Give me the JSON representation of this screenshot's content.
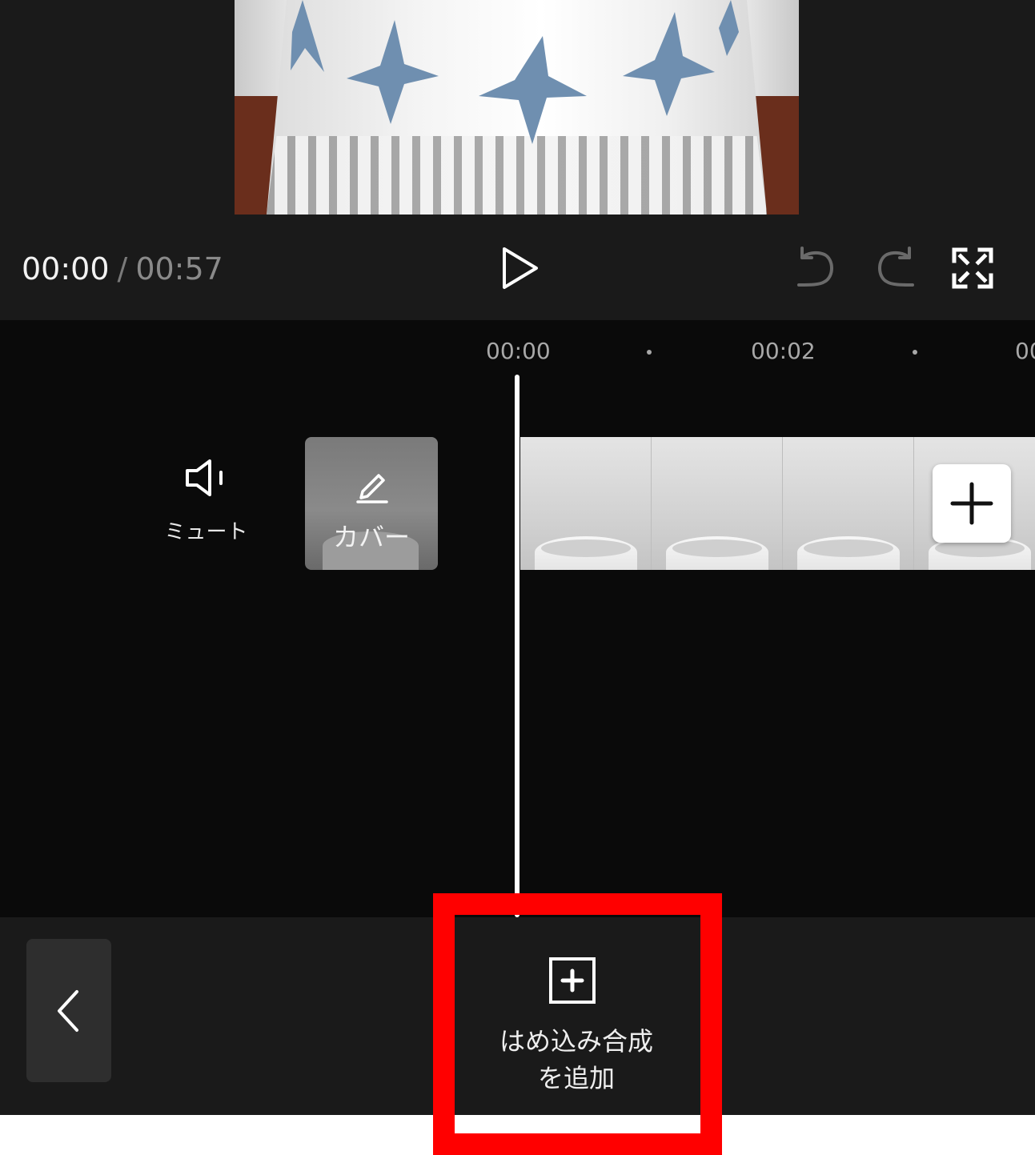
{
  "player": {
    "current_time": "00:00",
    "separator": "/",
    "total_time": "00:57"
  },
  "toolbar_icons": {
    "play": "play-icon",
    "undo": "undo-icon",
    "redo": "redo-icon",
    "fullscreen": "fullscreen-icon"
  },
  "timeline": {
    "ruler": [
      "00:00",
      "00:02",
      "00"
    ],
    "mute_label": "ミュート",
    "cover_label": "カバー"
  },
  "bottom_bar": {
    "add_chroma_label": "はめ込み合成\nを追加"
  },
  "colors": {
    "background": "#0a0a0a",
    "panel": "#1a1a1a",
    "highlight": "#ff0000"
  }
}
